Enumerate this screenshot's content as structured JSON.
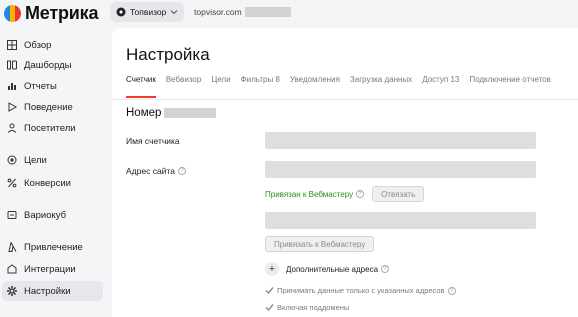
{
  "brand": {
    "name": "Метрика",
    "logo_colors": [
      "#1e88e5",
      "#ffb300",
      "#e53935"
    ]
  },
  "header": {
    "counter_name": "Топвизор",
    "site_prefix": "topvisor.com"
  },
  "sidebar": {
    "items": [
      {
        "label": "Обзор",
        "icon": "grid-icon"
      },
      {
        "label": "Дашборды",
        "icon": "dashboard-icon"
      },
      {
        "label": "Отчеты",
        "icon": "bar-chart-icon"
      },
      {
        "label": "Поведение",
        "icon": "play-icon"
      },
      {
        "label": "Посетители",
        "icon": "user-icon"
      },
      {
        "label": "Цели",
        "icon": "target-icon"
      },
      {
        "label": "Конверсии",
        "icon": "percent-icon"
      },
      {
        "label": "Вариокуб",
        "icon": "cube-icon"
      },
      {
        "label": "Привлечение",
        "icon": "funnel-icon"
      },
      {
        "label": "Интеграции",
        "icon": "puzzle-icon"
      },
      {
        "label": "Настройки",
        "icon": "gear-icon",
        "active": true
      }
    ]
  },
  "main": {
    "title": "Настройка",
    "tabs": [
      {
        "label": "Счетчик",
        "active": true
      },
      {
        "label": "Вебвизор"
      },
      {
        "label": "Цели"
      },
      {
        "label": "Фильтры 8"
      },
      {
        "label": "Уведомления"
      },
      {
        "label": "Загрузка данных"
      },
      {
        "label": "Доступ 13"
      },
      {
        "label": "Подключение отчетов"
      }
    ],
    "section_title": "Номер",
    "counter_name_label": "Имя счетчика",
    "site_address_label": "Адрес сайта",
    "help_glyph": "?",
    "webmaster_status": "Привязан к Вебмастеру",
    "unlink_label": "Отвязать",
    "link_webmaster_label": "Привязать к Вебмастеру",
    "plus_glyph": "+",
    "additional_addresses_label": "Дополнительные адреса",
    "only_specified_label": "Принимать данные только с указанных адресов",
    "subdomains_label": "Включая поддомены",
    "accent_color": "#f23a2f",
    "status_color": "#2e8b1f"
  }
}
